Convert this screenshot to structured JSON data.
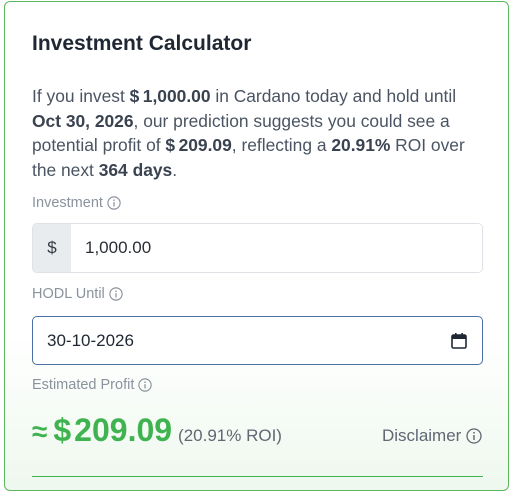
{
  "calculator": {
    "title": "Investment Calculator",
    "summary": {
      "p1": "If you invest ",
      "amount": "$ 1,000.00",
      "p2": " in Cardano today and hold until ",
      "date": "Oct 30, 2026",
      "p3": ", our prediction suggests you could see a potential profit of ",
      "profit": "$ 209.09",
      "p4": ", reflecting a ",
      "roi": "20.91%",
      "p5": " ROI over the next ",
      "days": "364 days",
      "p6": "."
    },
    "investment": {
      "label": "Investment",
      "currency_symbol": "$",
      "value": "1,000.00"
    },
    "hodl": {
      "label": "HODL Until",
      "value": "30-10-2026"
    },
    "estimate": {
      "label": "Estimated Profit",
      "approx_symbol": "≈",
      "currency_symbol": "$",
      "value": "209.09",
      "roi": "(20.91% ROI)",
      "disclaimer": "Disclaimer"
    },
    "colors": {
      "accent_green": "#3fb34f",
      "border_green": "#5cb85c",
      "focus_blue": "#4a6fa5"
    },
    "icons": {
      "info": "info-circle-icon",
      "calendar": "calendar-icon"
    }
  }
}
